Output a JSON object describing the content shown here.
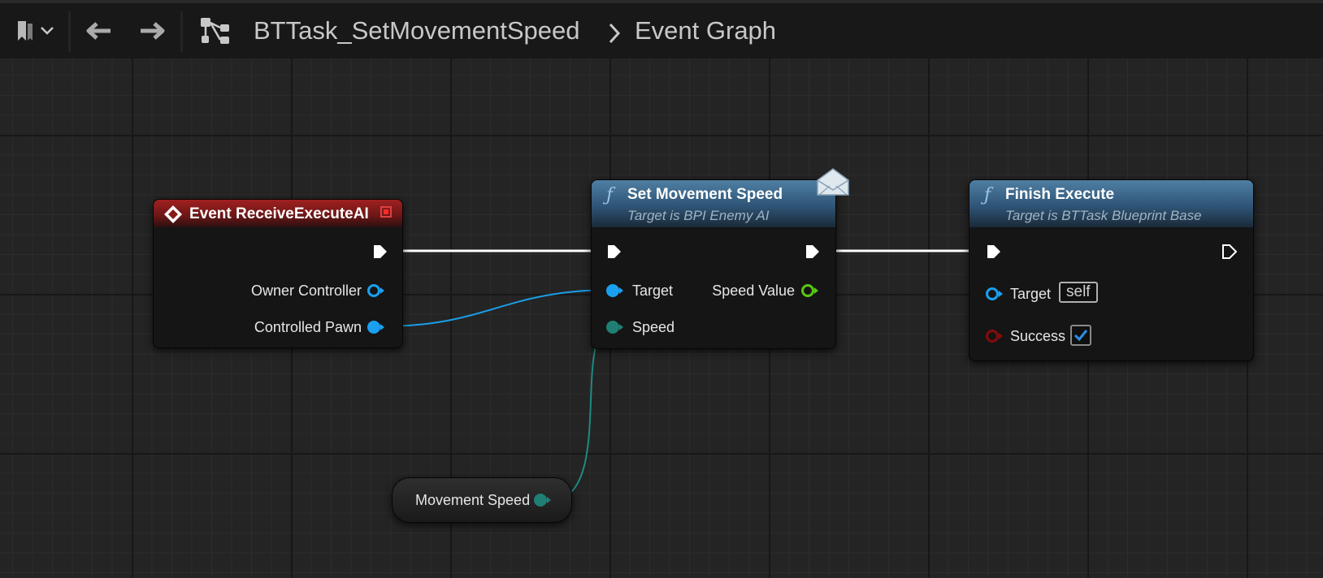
{
  "toolbar": {
    "breadcrumb_asset": "BTTask_SetMovementSpeed",
    "breadcrumb_graph": "Event Graph",
    "icons": [
      "bookmark-icon",
      "chevron-down-icon",
      "back-arrow-icon",
      "forward-arrow-icon",
      "graph-hierarchy-icon",
      "breadcrumb-chevron-icon"
    ]
  },
  "nodes": {
    "event_node": {
      "title": "Event ReceiveExecuteAI",
      "outputs": [
        "Owner Controller",
        "Controlled Pawn"
      ]
    },
    "set_speed_node": {
      "title": "Set Movement Speed",
      "subtitle": "Target is BPI Enemy AI",
      "inputs": [
        "Target",
        "Speed"
      ],
      "outputs": [
        "Speed Value"
      ]
    },
    "finish_node": {
      "title": "Finish Execute",
      "subtitle": "Target is BTTask Blueprint Base",
      "inputs": [
        "Target",
        "Success"
      ],
      "target_default": "self",
      "success_checked": true
    },
    "variable_node": {
      "label": "Movement Speed"
    }
  },
  "colors": {
    "event_header": "#a02020",
    "function_header": "#2f5577",
    "object_pin": "#1aa0f0",
    "float_pin": "#2a9488",
    "bool_pin": "#8a0a0a",
    "exec_pin": "#ffffff",
    "struct_pin": "#58c810"
  }
}
